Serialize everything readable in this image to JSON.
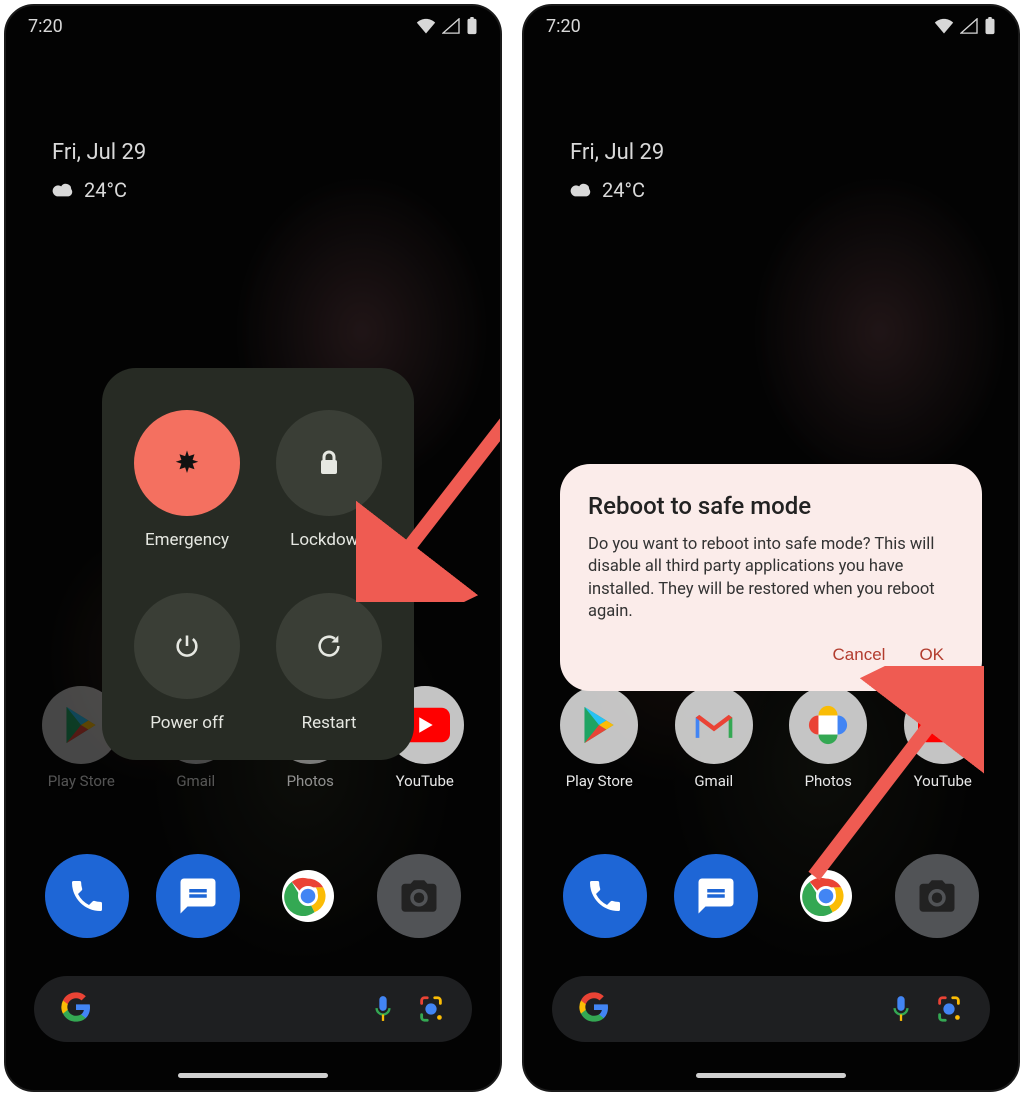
{
  "status": {
    "time": "7:20"
  },
  "home": {
    "date": "Fri, Jul 29",
    "temperature": "24°C"
  },
  "apps": [
    {
      "label": "Play Store",
      "icon": "play-store-icon"
    },
    {
      "label": "Gmail",
      "icon": "gmail-icon"
    },
    {
      "label": "Photos",
      "icon": "photos-icon"
    },
    {
      "label": "YouTube",
      "icon": "youtube-icon"
    }
  ],
  "power_menu": {
    "emergency": "Emergency",
    "lockdown": "Lockdown",
    "power_off": "Power off",
    "restart": "Restart"
  },
  "dialog": {
    "title": "Reboot to safe mode",
    "body": "Do you want to reboot into safe mode? This will disable all third party applications you have installed. They will be restored when you reboot again.",
    "cancel": "Cancel",
    "ok": "OK"
  },
  "colors": {
    "accent": "#f47060",
    "dialog_bg": "#fbecea",
    "dialog_action": "#b23c2e"
  }
}
